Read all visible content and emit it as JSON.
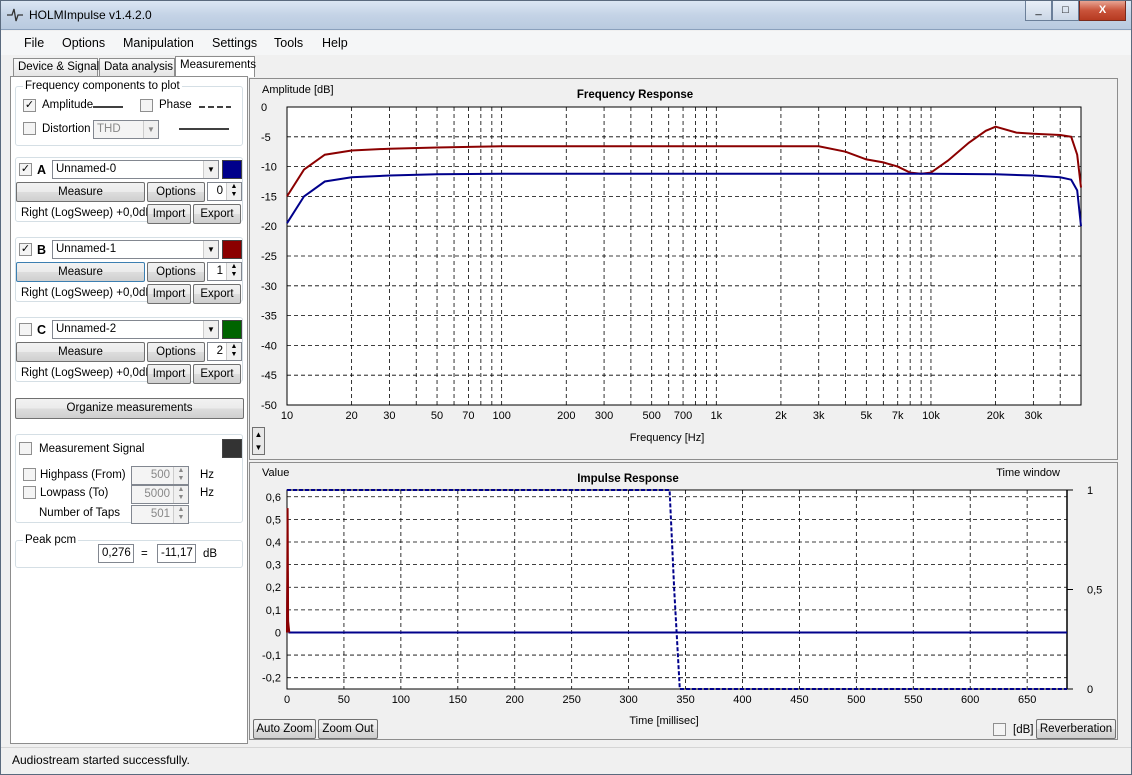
{
  "window": {
    "title": "HOLMImpulse  v1.4.2.0",
    "min": "_",
    "max": "□",
    "close": "X"
  },
  "menu": [
    "File",
    "Options",
    "Manipulation",
    "Settings",
    "Tools",
    "Help"
  ],
  "tabs": [
    "Device & Signal",
    "Data analysis",
    "Measurements"
  ],
  "left": {
    "freq_group_title": "Frequency components to plot",
    "amplitude_label": "Amplitude",
    "phase_label": "Phase",
    "distortion_label": "Distortion",
    "distortion_value": "THD",
    "measurements": [
      {
        "letter": "A",
        "name": "Unnamed-0",
        "checked": true,
        "color": "#00008b",
        "measure": "Measure",
        "options": "Options",
        "index": "0",
        "info": "Right (LogSweep) +0,0dB",
        "import": "Import",
        "export": "Export"
      },
      {
        "letter": "B",
        "name": "Unnamed-1",
        "checked": true,
        "color": "#8b0000",
        "measure": "Measure",
        "options": "Options",
        "index": "1",
        "info": "Right (LogSweep) +0,0dB",
        "import": "Import",
        "export": "Export"
      },
      {
        "letter": "C",
        "name": "Unnamed-2",
        "checked": false,
        "color": "#006400",
        "measure": "Measure",
        "options": "Options",
        "index": "2",
        "info": "Right (LogSweep) +0,0dB",
        "import": "Import",
        "export": "Export"
      }
    ],
    "organize": "Organize measurements",
    "signal_label": "Measurement Signal",
    "signal_color": "#333333",
    "highpass_label": "Highpass (From)",
    "highpass_value": "500",
    "lowpass_label": "Lowpass (To)",
    "lowpass_value": "5000",
    "taps_label": "Number of Taps",
    "taps_value": "501",
    "hz": "Hz",
    "peak_title": "Peak pcm",
    "peak_value": "0,276",
    "equals": "=",
    "peak_db": "-11,17",
    "db_unit": "dB"
  },
  "freq_chart": {
    "title": "Frequency Response",
    "ylabel": "Amplitude [dB]",
    "xlabel": "Frequency [Hz]",
    "y_ticks": [
      "0",
      "-5",
      "-10",
      "-15",
      "-20",
      "-25",
      "-30",
      "-35",
      "-40",
      "-45",
      "-50"
    ],
    "x_ticks": [
      "10",
      "20",
      "30",
      "50",
      "70",
      "100",
      "200",
      "300",
      "500",
      "700",
      "1k",
      "2k",
      "3k",
      "5k",
      "7k",
      "10k",
      "20k",
      "30k"
    ]
  },
  "imp_chart": {
    "title": "Impulse Response",
    "ylabel": "Value",
    "xlabel": "Time [millisec]",
    "right_label": "Time window",
    "y_ticks": [
      "0,6",
      "0,5",
      "0,4",
      "0,3",
      "0,2",
      "0,1",
      "0",
      "-0,1",
      "-0,2"
    ],
    "right_ticks": [
      "1",
      "0,5",
      "0"
    ],
    "x_ticks": [
      "0",
      "50",
      "100",
      "150",
      "200",
      "250",
      "300",
      "350",
      "400",
      "450",
      "500",
      "550",
      "600",
      "650"
    ]
  },
  "bottom": {
    "auto_zoom": "Auto Zoom",
    "zoom_out": "Zoom Out",
    "db": "[dB]",
    "reverberation": "Reverberation"
  },
  "status": "Audiostream started successfully.",
  "chart_data": [
    {
      "type": "line",
      "title": "Frequency Response",
      "xlabel": "Frequency [Hz]",
      "ylabel": "Amplitude [dB]",
      "xscale": "log",
      "xlim": [
        10,
        50000
      ],
      "ylim": [
        -50,
        0
      ],
      "grid": true,
      "series": [
        {
          "color": "#8b0000",
          "x": [
            10,
            12,
            15,
            20,
            30,
            50,
            100,
            300,
            1000,
            3000,
            4000,
            5000,
            6000,
            7000,
            8000,
            9000,
            10000,
            12000,
            15000,
            18000,
            20000,
            25000,
            30000,
            40000,
            45000,
            48000,
            50000
          ],
          "y": [
            -15,
            -10.5,
            -8,
            -7.3,
            -7,
            -6.8,
            -6.6,
            -6.6,
            -6.6,
            -6.6,
            -7.5,
            -8.8,
            -9.3,
            -10,
            -11,
            -11.2,
            -11,
            -9,
            -6,
            -4,
            -3.3,
            -4.3,
            -4.5,
            -4.7,
            -5,
            -8,
            -13.5
          ]
        },
        {
          "color": "#00008b",
          "x": [
            10,
            12,
            15,
            20,
            30,
            50,
            100,
            1000,
            10000,
            20000,
            30000,
            40000,
            45000,
            48000,
            50000
          ],
          "y": [
            -19.5,
            -15,
            -12.5,
            -11.8,
            -11.5,
            -11.3,
            -11.2,
            -11.2,
            -11.2,
            -11.3,
            -11.5,
            -11.8,
            -12.2,
            -14,
            -20
          ]
        }
      ]
    },
    {
      "type": "line",
      "title": "Impulse Response",
      "xlabel": "Time [millisec]",
      "ylabel": "Value",
      "xlim": [
        0,
        685
      ],
      "ylim": [
        -0.25,
        0.63
      ],
      "grid": true,
      "series": [
        {
          "color": "#00008b",
          "x": [
            0,
            0.5,
            1,
            2,
            685
          ],
          "y": [
            0,
            0.27,
            0.02,
            0,
            0
          ]
        },
        {
          "color": "#8b0000",
          "x": [
            0,
            0.5,
            1,
            2
          ],
          "y": [
            0,
            0.55,
            0.05,
            0
          ]
        },
        {
          "name": "Time window",
          "color": "#00008b",
          "dashed": true,
          "right_axis": true,
          "x": [
            0,
            336,
            340,
            345,
            685
          ],
          "y": [
            1,
            1,
            0.5,
            0,
            0
          ]
        }
      ]
    }
  ]
}
